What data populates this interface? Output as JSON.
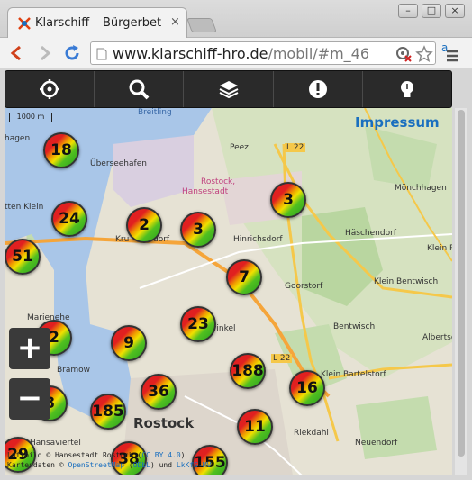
{
  "browser": {
    "tab_title": "Klarschiff – Bürgerbet",
    "tab_close": "×",
    "url_host": "www.klarschiff-hro.de",
    "url_path": "/mobil/#m_46",
    "min_label": "–",
    "max_label": "□",
    "close_label": "×"
  },
  "app": {
    "buttons": [
      "locate-icon",
      "search-icon",
      "layers-icon",
      "alert-icon",
      "idea-icon"
    ],
    "impressum": "Impressum",
    "zoom_in": "+",
    "zoom_out": "−",
    "scale_label": "1000 m"
  },
  "map": {
    "labels": {
      "peez": "Peez",
      "ueberseehafen": "Überseehafen",
      "rostock_hanse": "Rostock,",
      "hansestadt": "Hansestadt",
      "moenchhagen": "Mönchhagen",
      "haeschendorf": "Häschendorf",
      "hinrichsdorf": "Hinrichsdorf",
      "goorstorf": "Goorstorf",
      "klein_bentwisch": "Klein Bentwisch",
      "bentwisch": "Bentwisch",
      "albertsdorf": "Albertsd",
      "klein_bartelstorf": "Klein Bartelstorf",
      "bramow": "Bramow",
      "rostock": "Rostock",
      "riekdahl": "Riekdahl",
      "neuendorf": "Neuendorf",
      "hansaviertel": "Hansaviertel",
      "l22a": "L 22",
      "l22b": "L 22",
      "breitling": "Breitling",
      "klein_r": "Klein R",
      "ttenklein": "tten Klein",
      "hagen": "hagen",
      "marienehe": "Marienehe",
      "kru": "Kru",
      "dorf": "dorf",
      "winkel": "winkel"
    },
    "clusters": [
      {
        "id": "c18",
        "count": "18"
      },
      {
        "id": "c24",
        "count": "24"
      },
      {
        "id": "c51",
        "count": "51"
      },
      {
        "id": "c2a",
        "count": "2"
      },
      {
        "id": "c3a",
        "count": "3"
      },
      {
        "id": "c3b",
        "count": "3"
      },
      {
        "id": "c7",
        "count": "7"
      },
      {
        "id": "c23",
        "count": "23"
      },
      {
        "id": "c2b",
        "count": "2"
      },
      {
        "id": "c9",
        "count": "9"
      },
      {
        "id": "c188",
        "count": "188"
      },
      {
        "id": "c16",
        "count": "16"
      },
      {
        "id": "c36",
        "count": "36"
      },
      {
        "id": "c8",
        "count": "8"
      },
      {
        "id": "c185",
        "count": "185"
      },
      {
        "id": "c11",
        "count": "11"
      },
      {
        "id": "c29",
        "count": "29"
      },
      {
        "id": "c38",
        "count": "38"
      },
      {
        "id": "c155",
        "count": "155"
      }
    ],
    "attribution_line1_pre": "Luftbild © Hansestadt Rostock (",
    "attribution_line1_link": "CC BY 4.0",
    "attribution_line1_post": ")",
    "attribution_line2_pre": "Kartendaten © ",
    "attribution_line2_link1": "OpenStreetMap",
    "attribution_line2_mid": " (",
    "attribution_line2_link2": "ODbL",
    "attribution_line2_post": ") und ",
    "attribution_line2_link3": "LkKfS-MV"
  },
  "colors": {
    "accent": "#1a6fbf",
    "appbar": "#2a2a2a",
    "water": "#a9c6e8",
    "green": "#b9d6a0"
  }
}
